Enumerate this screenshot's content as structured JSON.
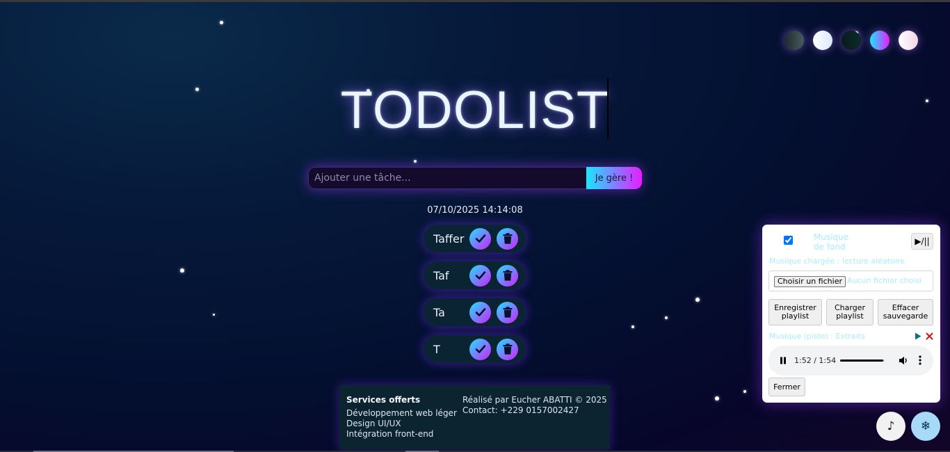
{
  "app": {
    "title": "TODOLIST",
    "datetime": "07/10/2025 14:14:08"
  },
  "theme_switcher": {
    "swatches": [
      {
        "name": "theme-dark-slate",
        "colors": [
          "#1b2b2e",
          "#4b5a5e"
        ]
      },
      {
        "name": "theme-frost",
        "colors": [
          "#ffffff",
          "#dbe8ff"
        ]
      },
      {
        "name": "theme-deep-teal",
        "colors": [
          "#081c1c",
          "#0c2a2a"
        ]
      },
      {
        "name": "theme-neon",
        "colors": [
          "#18e8ff",
          "#e81cff"
        ]
      },
      {
        "name": "theme-blush",
        "colors": [
          "#ffffff",
          "#f3d6e6"
        ]
      }
    ]
  },
  "todo_form": {
    "placeholder": "Ajouter une tâche...",
    "submit_label": "Je gère !"
  },
  "tasks": [
    {
      "label": "Taffer"
    },
    {
      "label": "Taf"
    },
    {
      "label": "Ta"
    },
    {
      "label": "T"
    }
  ],
  "footer": {
    "services_heading": "Services offerts",
    "services": [
      "Développement web léger",
      "Design UI/UX",
      "Intégration front-end"
    ],
    "credit": "Réalisé par Eucher ABATTI © 2025",
    "contact": "Contact: +229 0157002427"
  },
  "music_panel": {
    "background_toggle_label": "Musique de fond",
    "play_pause_label": "▶/||",
    "status_text": "Musique chargée : lecture aléatoire",
    "file_button_label": "Choisir un fichier",
    "file_status": "Aucun fichier choisi",
    "save_playlist_label": "Enregistrer playlist",
    "load_playlist_label": "Charger playlist",
    "clear_save_label": "Effacer sauvegarde",
    "track_name": "Musique (piste) : Extraits",
    "time_display": "1:52 / 1:54",
    "progress": 0.97,
    "close_label": "Fermer"
  },
  "fab": {
    "music_icon": "♪",
    "snow_icon": "❄"
  },
  "colors": {
    "accent_start": "#18e8ff",
    "accent_end": "#e81cff",
    "task_bg": "#0b2434"
  }
}
